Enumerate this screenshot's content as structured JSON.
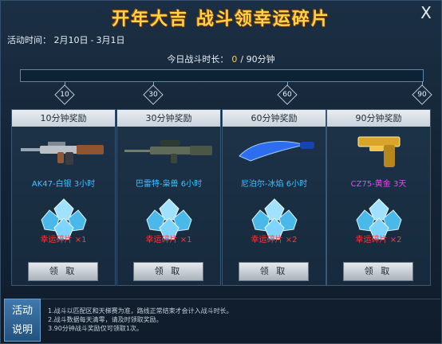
{
  "window": {
    "title": "开年大吉  战斗领幸运碎片",
    "close_label": "X"
  },
  "activity": {
    "label": "活动时间：",
    "start": "2月10日",
    "sep": "-",
    "end": "3月1日"
  },
  "battle": {
    "label": "今日战斗时长：",
    "current": "0",
    "suffix": "/ 90分钟"
  },
  "progress": {
    "value": 0,
    "max": 90
  },
  "milestones": [
    "10",
    "30",
    "60",
    "90"
  ],
  "cards": [
    {
      "header": "10分钟奖励",
      "item": "AK47-白银 3小时",
      "item_color": "#3fc3ff",
      "reward": "幸运碎片 ×1",
      "button": "领 取",
      "weapon_icon": "rifle-icon"
    },
    {
      "header": "30分钟奖励",
      "item": "巴雷特-枭兽 6小时",
      "item_color": "#3fc3ff",
      "reward": "幸运碎片 ×1",
      "button": "领 取",
      "weapon_icon": "sniper-icon"
    },
    {
      "header": "60分钟奖励",
      "item": "尼泊尔-冰焰 6小时",
      "item_color": "#3fc3ff",
      "reward": "幸运碎片 ×2",
      "button": "领 取",
      "weapon_icon": "knife-icon"
    },
    {
      "header": "90分钟奖励",
      "item": "CZ75-黄金 3天",
      "item_color": "#e04cf2",
      "reward": "幸运碎片 ×2",
      "button": "领 取",
      "weapon_icon": "pistol-icon"
    }
  ],
  "notes": {
    "badge": [
      "活动",
      "说明"
    ],
    "items": [
      "1.战斗以匹配区和天梯赛为准，路线正常结束才会计入战斗时长。",
      "2.战斗数据每天清零，请及时领取奖励。",
      "3.90分钟战斗奖励仅可领取1次。"
    ]
  }
}
